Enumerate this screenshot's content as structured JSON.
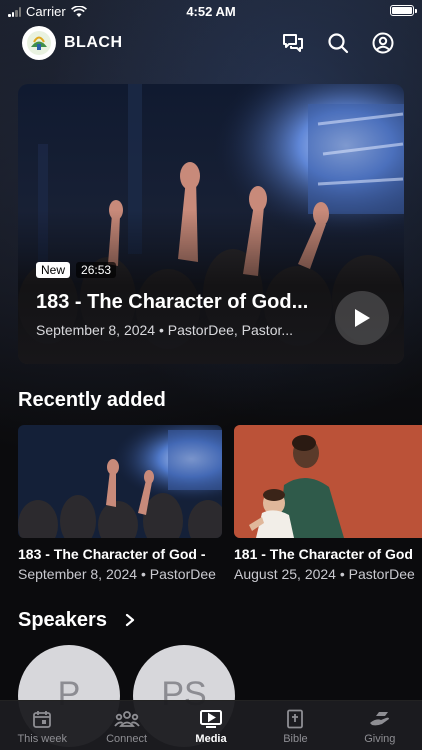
{
  "status_bar": {
    "carrier": "Carrier",
    "time": "4:52 AM"
  },
  "header": {
    "title": "BLACH",
    "icons": [
      "chat-icon",
      "search-icon",
      "account-icon"
    ]
  },
  "featured": {
    "badge_new": "New",
    "duration": "26:53",
    "title": "183 - The Character of God...",
    "meta": "September 8, 2024 • PastorDee, Pastor..."
  },
  "recently_added": {
    "heading": "Recently added",
    "items": [
      {
        "title": "183 - The Character of God - ",
        "meta": "September 8, 2024 • PastorDee"
      },
      {
        "title": "181 - The Character of God",
        "meta": "August 25, 2024 • PastorDee"
      }
    ]
  },
  "speakers": {
    "heading": "Speakers",
    "items": [
      {
        "initials": "P"
      },
      {
        "initials": "PS"
      }
    ]
  },
  "tab_bar": {
    "active": "Media",
    "tabs": [
      {
        "label": "This week",
        "icon": "calendar-icon"
      },
      {
        "label": "Connect",
        "icon": "people-icon"
      },
      {
        "label": "Media",
        "icon": "media-play-icon"
      },
      {
        "label": "Bible",
        "icon": "bible-icon"
      },
      {
        "label": "Giving",
        "icon": "giving-hand-icon"
      }
    ]
  },
  "colors": {
    "background": "#0b0b0d",
    "tab_active": "#ffffff",
    "tab_inactive": "#8e8e93"
  }
}
